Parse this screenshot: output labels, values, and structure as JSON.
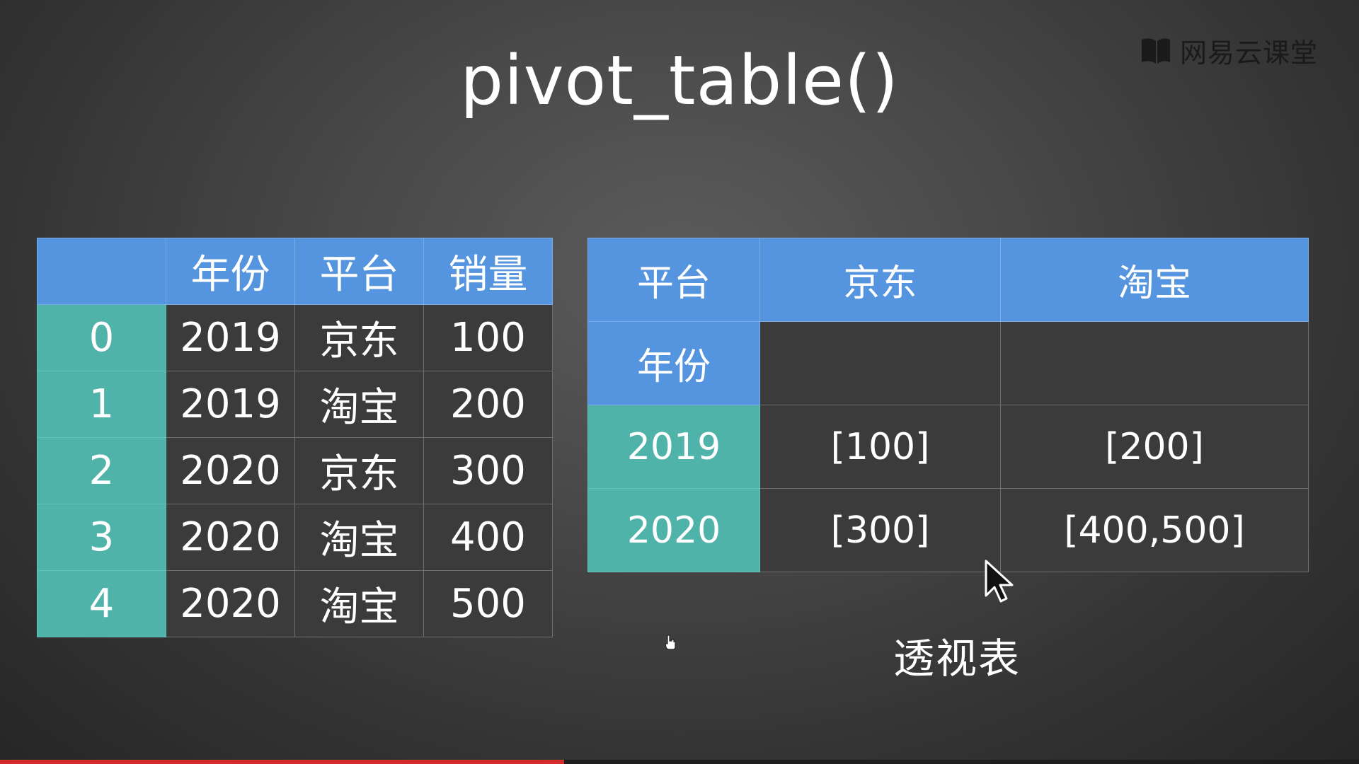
{
  "brand": {
    "name": "网易云课堂"
  },
  "title": "pivot_table()",
  "source_table": {
    "headers": [
      "",
      "年份",
      "平台",
      "销量"
    ],
    "rows": [
      {
        "index": "0",
        "year": "2019",
        "platform": "京东",
        "sales": "100"
      },
      {
        "index": "1",
        "year": "2019",
        "platform": "淘宝",
        "sales": "200"
      },
      {
        "index": "2",
        "year": "2020",
        "platform": "京东",
        "sales": "300"
      },
      {
        "index": "3",
        "year": "2020",
        "platform": "淘宝",
        "sales": "400"
      },
      {
        "index": "4",
        "year": "2020",
        "platform": "淘宝",
        "sales": "500"
      }
    ]
  },
  "pivot_table": {
    "columns_label": "平台",
    "columns": [
      "京东",
      "淘宝"
    ],
    "index_label": "年份",
    "rows": [
      {
        "year": "2019",
        "jd": "[100]",
        "taobao": "[200]"
      },
      {
        "year": "2020",
        "jd": "[300]",
        "taobao": "[400,500]"
      }
    ]
  },
  "caption": "透视表",
  "progress": {
    "fraction": 0.415
  },
  "colors": {
    "header_blue": "#5594de",
    "index_teal": "#4fb3a9",
    "cell_dark": "#3b3b3b",
    "progress_red": "#d62b2b"
  }
}
